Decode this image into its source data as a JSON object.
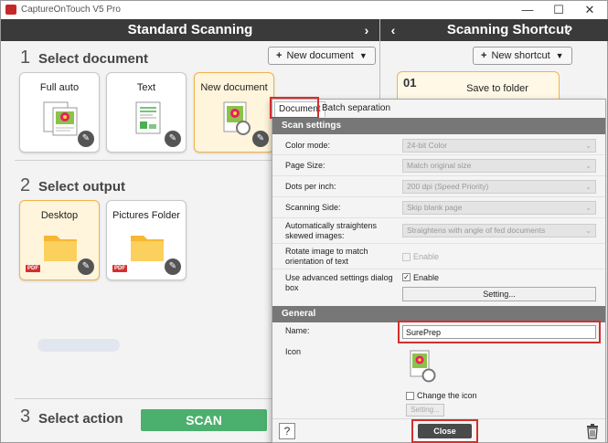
{
  "window": {
    "title": "CaptureOnTouch V5 Pro",
    "controls": {
      "minimize": "—",
      "maximize": "☐",
      "close": "✕"
    }
  },
  "left_panel": {
    "header": "Standard Scanning",
    "forward_arrow": "›",
    "section1": {
      "number": "1",
      "title": "Select document",
      "new_button": "New document",
      "tiles": [
        {
          "label": "Full auto",
          "icon": "photo-document-icon"
        },
        {
          "label": "Text",
          "icon": "text-document-icon"
        },
        {
          "label": "New document",
          "icon": "photo-document-icon",
          "selected": true
        }
      ]
    },
    "section2": {
      "number": "2",
      "title": "Select output",
      "tiles": [
        {
          "label": "Desktop",
          "icon": "folder-icon",
          "badge": "PDF",
          "selected": true
        },
        {
          "label": "Pictures Folder",
          "icon": "folder-icon",
          "badge": "PDF"
        }
      ]
    },
    "section3": {
      "number": "3",
      "title": "Select action",
      "scan_button": "SCAN"
    }
  },
  "right_panel": {
    "header": "Scanning Shortcut",
    "back_arrow": "‹",
    "help": "?",
    "new_button": "New shortcut",
    "card": {
      "number": "01",
      "label": "Save to folder"
    }
  },
  "dialog": {
    "tabs": [
      "Document",
      "Batch separation"
    ],
    "scan_settings": {
      "header": "Scan settings",
      "rows": [
        {
          "label": "Color mode:",
          "value": "24-bit Color"
        },
        {
          "label": "Page Size:",
          "value": "Match original size"
        },
        {
          "label": "Dots per inch:",
          "value": "200 dpi (Speed Priority)"
        },
        {
          "label": "Scanning Side:",
          "value": "Skip blank page"
        },
        {
          "label": "Automatically straightens skewed images:",
          "value": "Straightens with angle of fed documents"
        }
      ],
      "rotate": {
        "label": "Rotate image to match orientation of text",
        "checkbox_label": "Enable"
      },
      "advanced": {
        "label": "Use advanced settings dialog box",
        "checkbox_label": "Enable",
        "button": "Setting..."
      }
    },
    "general": {
      "header": "General",
      "name_label": "Name:",
      "name_value": "SurePrep",
      "icon_label": "Icon",
      "change_icon_label": "Change the icon",
      "setting_button": "Setting..."
    },
    "footer": {
      "help": "?",
      "close": "Close"
    }
  },
  "colors": {
    "header_bg": "#3a3a3a",
    "selected_border": "#f2b24c",
    "scan_button": "#4caf6e",
    "highlight_red": "#d32f2f",
    "group_header": "#777777"
  }
}
